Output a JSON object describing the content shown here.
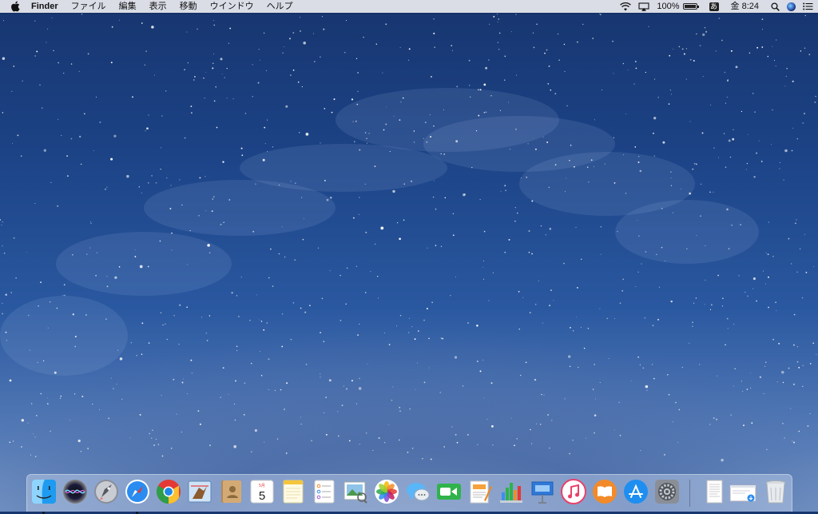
{
  "menubar": {
    "app_name": "Finder",
    "menus": [
      "ファイル",
      "編集",
      "表示",
      "移動",
      "ウインドウ",
      "ヘルプ"
    ],
    "battery_percent": "100%",
    "battery_level": 1.0,
    "ime_label": "あ",
    "clock": "金 8:24",
    "icons": [
      "apple-logo-icon",
      "wifi-icon",
      "airplay-icon",
      "battery-icon",
      "input-method-icon",
      "spotlight-search-icon",
      "siri-icon",
      "notification-center-icon"
    ]
  },
  "dock": {
    "apps": [
      {
        "icon": "finder-icon",
        "running": true
      },
      {
        "icon": "siri-icon",
        "running": false
      },
      {
        "icon": "launchpad-icon",
        "running": false
      },
      {
        "icon": "safari-icon",
        "running": true
      },
      {
        "icon": "chrome-icon",
        "running": false
      },
      {
        "icon": "mail-icon",
        "running": false
      },
      {
        "icon": "contacts-icon",
        "running": false
      },
      {
        "icon": "calendar-icon",
        "running": false
      },
      {
        "icon": "notes-icon",
        "running": false
      },
      {
        "icon": "reminders-icon",
        "running": false
      },
      {
        "icon": "preview-icon",
        "running": false
      },
      {
        "icon": "photos-icon",
        "running": false
      },
      {
        "icon": "messages-icon",
        "running": false
      },
      {
        "icon": "facetime-icon",
        "running": false
      },
      {
        "icon": "pages-icon",
        "running": false
      },
      {
        "icon": "numbers-icon",
        "running": false
      },
      {
        "icon": "keynote-icon",
        "running": false
      },
      {
        "icon": "itunes-icon",
        "running": false
      },
      {
        "icon": "ibooks-icon",
        "running": false
      },
      {
        "icon": "app-store-icon",
        "running": false
      },
      {
        "icon": "system-preferences-icon",
        "running": false
      }
    ],
    "calendar": {
      "month": "5月",
      "day": "5"
    },
    "others": [
      {
        "icon": "document-stack-icon"
      },
      {
        "icon": "downloads-stack-icon"
      },
      {
        "icon": "trash-icon"
      }
    ]
  },
  "colors": {
    "menubar_bg": "#ececf0",
    "sky_top": "#17356f",
    "sky_bottom": "#7e9cc9"
  }
}
